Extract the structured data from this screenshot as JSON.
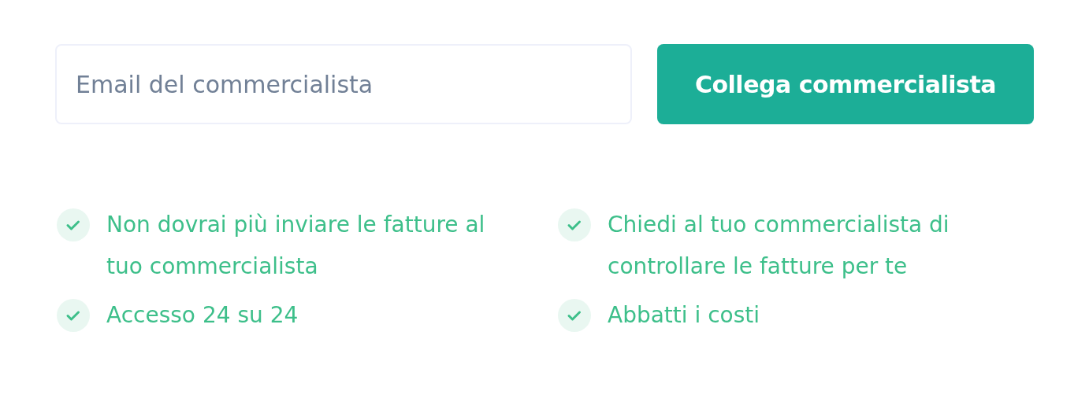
{
  "form": {
    "email_field": {
      "placeholder": "Email del commercialista"
    },
    "submit_button": "Collega commercialista"
  },
  "benefits": [
    {
      "text": "Non dovrai più inviare le fatture al tuo commercialista",
      "checked": true
    },
    {
      "text": "Chiedi al tuo commercialista di controllare le fatture per te",
      "checked": true
    },
    {
      "text": "Accesso 24 su 24",
      "checked": true
    },
    {
      "text": "Abbatti i costi",
      "checked": true
    }
  ]
}
